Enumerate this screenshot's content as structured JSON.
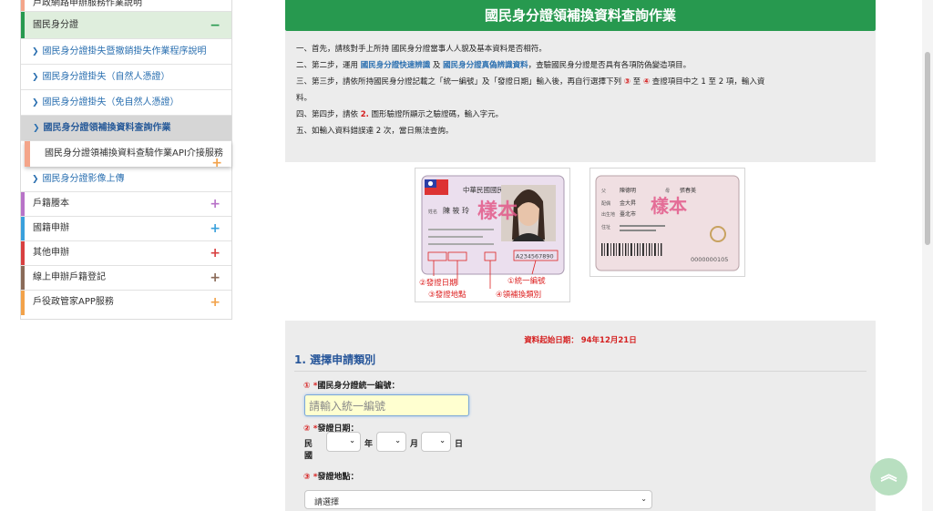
{
  "sidebar": {
    "top_item": "戶政網路申辦服務作業說明",
    "active_category": {
      "label": "國民身分證",
      "sign": "−"
    },
    "sub_items": [
      {
        "label": "國民身分證掛失暨撤銷掛失作業程序說明"
      },
      {
        "label": "國民身分證掛失（自然人憑證）"
      },
      {
        "label": "國民身分證掛失（免自然人憑證）"
      },
      {
        "label": "國民身分證領補換資料查詢作業"
      },
      {
        "label": "國民身分證領補換資料查驗作業API介接服務"
      },
      {
        "label": "國民身分證影像上傳"
      }
    ],
    "categories": [
      {
        "label": "戶籍謄本",
        "sign": "+",
        "color": "#b873c8"
      },
      {
        "label": "國籍申辦",
        "sign": "+",
        "color": "#3aa0dc"
      },
      {
        "label": "其他申辦",
        "sign": "+",
        "color": "#d84040"
      },
      {
        "label": "線上申辦戶籍登記",
        "sign": "+",
        "color": "#8a6a58"
      },
      {
        "label": "戶役政管家APP服務",
        "sign": "+",
        "color": "#f2a24a"
      }
    ]
  },
  "main": {
    "title": "國民身分證領補換資料查詢作業",
    "instructions": {
      "line1": "一、首先，請核對手上所持 國民身分證當事人人貌及基本資料是否相符。",
      "line2_a": "二、第二步，運用 ",
      "line2_link1": "國民身分證快速辨識",
      "line2_b": " 及 ",
      "line2_link2": "國民身分證真偽辨識資料",
      "line2_c": "，查驗國民身分證是否具有各項防偽變造項目。",
      "line3_a": "三、第三步，請依所持國民身分證記載之「統一編號」及「發證日期」輸入後，再自行選擇下列 ",
      "line3_n3": "③",
      "line3_b": " 至 ",
      "line3_n4": "④",
      "line3_c": " 查證項目中之 1 至 2 項，輸入資",
      "line3_d": "料。",
      "line4_a": "四、第四步，請依 ",
      "line4_n2": "2.",
      "line4_b": " 圖形驗證所顯示之驗證碼，輸入字元。",
      "line5": "五、如輸入資料錯誤達 2 次，當日無法查詢。"
    },
    "card_front": {
      "header": "中華民國國民身分證",
      "name_label": "姓名",
      "name": "陳 筱 玲",
      "id_number": "A234567890",
      "sample_mark": "樣本",
      "callout_1": "①統一編號",
      "callout_2": "②發證日期",
      "callout_3": "③發證地點",
      "callout_4": "④領補換類別"
    },
    "card_back": {
      "father_label": "父",
      "father": "陳德明",
      "mother_label": "母",
      "mother": "張春美",
      "spouse_label": "配偶",
      "spouse": "金大昇",
      "birthplace_label": "出生地",
      "birthplace": "臺北市",
      "address_label": "住址",
      "sample_mark": "樣本",
      "serial": "0000000105"
    },
    "form": {
      "date_note": "資料起始日期： 94年12月21日",
      "section_title": "1. 選擇申請類別",
      "field1": {
        "num": "①",
        "star": "*",
        "label": "國民身分證統一編號：",
        "placeholder": "請輸入統一編號"
      },
      "field2": {
        "num": "②",
        "star": "*",
        "label": "發證日期："
      },
      "date_prefix": "民國",
      "year_unit": "年",
      "month_unit": "月",
      "day_unit": "日",
      "field3": {
        "num": "③",
        "star": "*",
        "label": "發證地點："
      },
      "place_select": "請選擇"
    }
  },
  "scroll_top_icon": "double-chevron-up-icon"
}
